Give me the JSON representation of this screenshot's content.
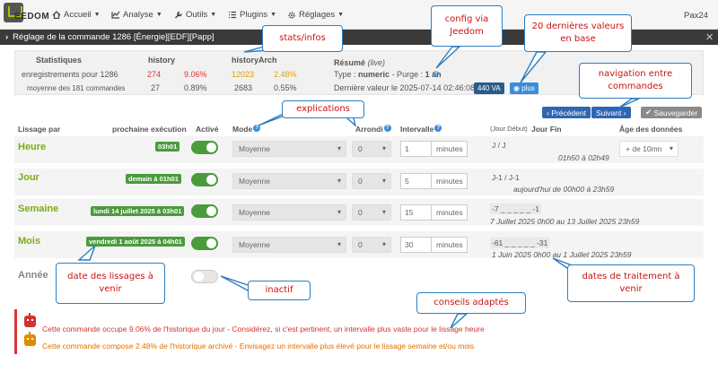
{
  "nav": {
    "logo_text": "EEDOM",
    "items": [
      {
        "label": "Accueil",
        "icon": "home-icon"
      },
      {
        "label": "Analyse",
        "icon": "analysis-icon"
      },
      {
        "label": "Outils",
        "icon": "wrench-icon"
      },
      {
        "label": "Plugins",
        "icon": "list-icon"
      },
      {
        "label": "Réglages",
        "icon": "gear-icon"
      }
    ],
    "user": "Pax24"
  },
  "title": "Réglage de la commande 1286 [Énergie][EDF][Papp]",
  "summary": {
    "col_stats": "Statistiques",
    "col_history": "history",
    "col_history_arch": "historyArch",
    "row1": {
      "label": "enregistrements pour 1286",
      "h_count": "274",
      "h_pct": "9.06%",
      "a_count": "12023",
      "a_pct": "2.48%"
    },
    "row2": {
      "label": "moyenne des 181 commandes",
      "h_count": "27",
      "h_pct": "0.89%",
      "a_count": "2683",
      "a_pct": "0.55%"
    },
    "resume_title": "Résumé",
    "resume_live": "(live)",
    "type_prefix": "Type :",
    "type_value": "numeric",
    "purge_prefix": "- Purge :",
    "purge_value": "1 an",
    "last_value": "Dernière valeur le 2025-07-14 02:46:08 :",
    "last_badge": "440 VA",
    "plus_badge": "plus"
  },
  "buttons": {
    "prev": "Précédent",
    "next": "Suivant",
    "save": "Sauvegarder"
  },
  "headers": {
    "lissage": "Lissage par",
    "prochaine": "prochaine exécution",
    "actif": "Activé",
    "mode": "Mode",
    "arrondi": "Arrondi",
    "intervalle": "Intervalle",
    "jour_debut": "(Jour Début)",
    "jour_fin": "Jour Fin",
    "age": "Âge des données"
  },
  "rows": [
    {
      "label": "Heure",
      "next": "03h01",
      "mode": "Moyenne",
      "arrondi": "0",
      "interval": "1",
      "unit": "minutes",
      "d1": "J / J",
      "d2": "01h50 à 02h49",
      "age": "+ de 10mn"
    },
    {
      "label": "Jour",
      "next": "demain à 01h01",
      "mode": "Moyenne",
      "arrondi": "0",
      "interval": "5",
      "unit": "minutes",
      "d1": "J-1 / J-1",
      "d2": "aujourd'hui de 00h00 à 23h59"
    },
    {
      "label": "Semaine",
      "next": "lundi 14 juillet 2025 à 03h01",
      "mode": "Moyenne",
      "arrondi": "0",
      "interval": "15",
      "unit": "minutes",
      "d1": "-7 _ _ _ _ _ -1",
      "d2": "7 Juillet 2025 0h00 au 13 Juillet 2025 23h59"
    },
    {
      "label": "Mois",
      "next": "vendredi 1 août 2025 à 04h01",
      "mode": "Moyenne",
      "arrondi": "0",
      "interval": "30",
      "unit": "minutes",
      "d1": "-61 _ _ _ _ _ -31",
      "d2": "1 Juin 2025 0h00 au 1 Juillet 2025 23h59"
    },
    {
      "label": "Année"
    }
  ],
  "alerts": [
    {
      "text": "Cette commande occupe 9.06% de l'historique du jour - Considérez, si c'est pertinent, un intervalle plus vaste pour le lissage heure",
      "color": "#d33333"
    },
    {
      "text": "Cette commande compose 2.48% de l'historique archivé - Envisagez un intervalle plus élevé pour le lissage semaine et/ou mois",
      "color": "#e07000"
    }
  ],
  "annotations": {
    "stats": "stats/infos",
    "config": "config via Jeedom",
    "last20": "20 dernières valeurs en base",
    "navigation": "navigation entre commandes",
    "explications": "explications",
    "dates_lissage": "date des lissages à venir",
    "inactif": "inactif",
    "dates_traitement": "dates de traitement à venir",
    "conseils": "conseils adaptés"
  }
}
